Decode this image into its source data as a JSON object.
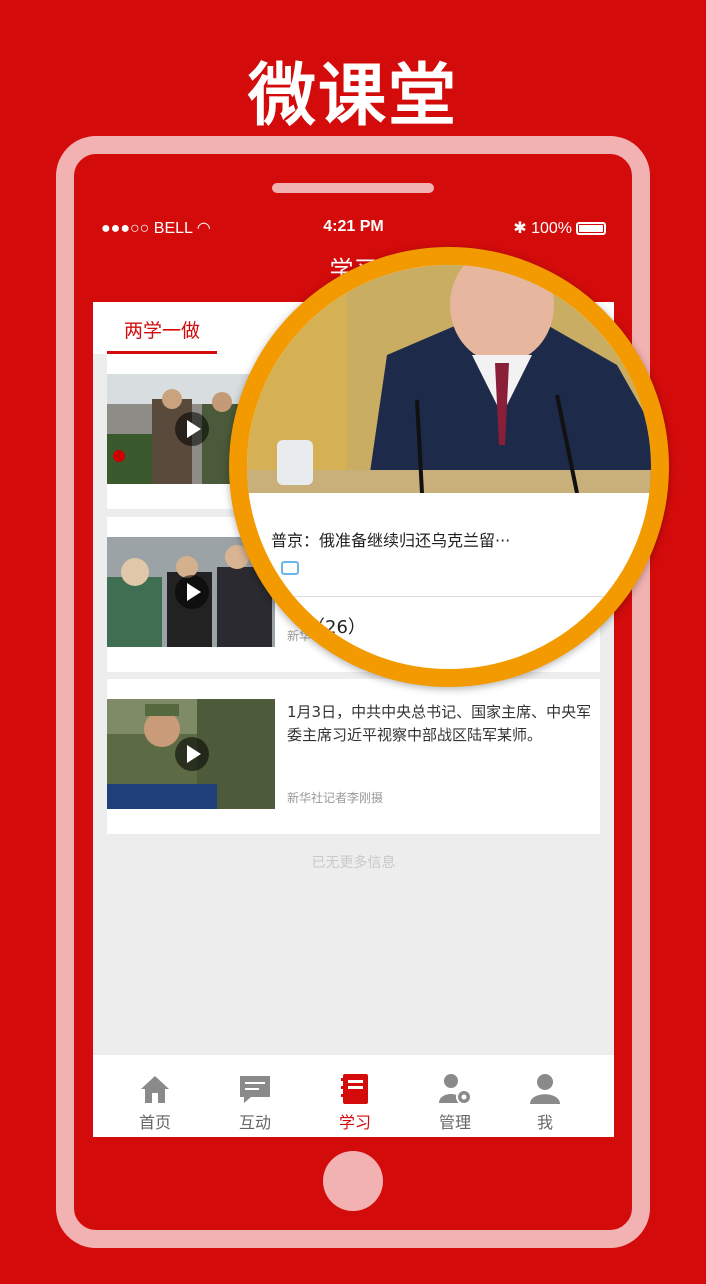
{
  "headline": "微课堂",
  "status_bar": {
    "carrier": "●●●○○ BELL",
    "time": "4:21 PM",
    "battery": "100%"
  },
  "nav_title": "学习",
  "section_tab": "两学一做",
  "articles": [
    {
      "text": "",
      "source": ""
    },
    {
      "text": "",
      "source": "新华"
    },
    {
      "text": "1月3日，中共中央总书记、国家主席、中央军委主席习近平视察中部战区陆军某师。",
      "source": "新华社记者李刚摄"
    }
  ],
  "end_note": "已无更多信息",
  "magnifier": {
    "headline": "普京：俄准备继续归还乌克兰留···",
    "count": "（26）"
  },
  "tabbar": [
    {
      "label": "首页",
      "icon": "home-icon"
    },
    {
      "label": "互动",
      "icon": "chat-icon"
    },
    {
      "label": "学习",
      "icon": "book-icon"
    },
    {
      "label": "管理",
      "icon": "user-gear-icon"
    },
    {
      "label": "我",
      "icon": "user-icon"
    }
  ],
  "colors": {
    "brand": "#d40b0b",
    "frame": "#f3b2b2",
    "magnifier_ring": "#f39a00"
  }
}
